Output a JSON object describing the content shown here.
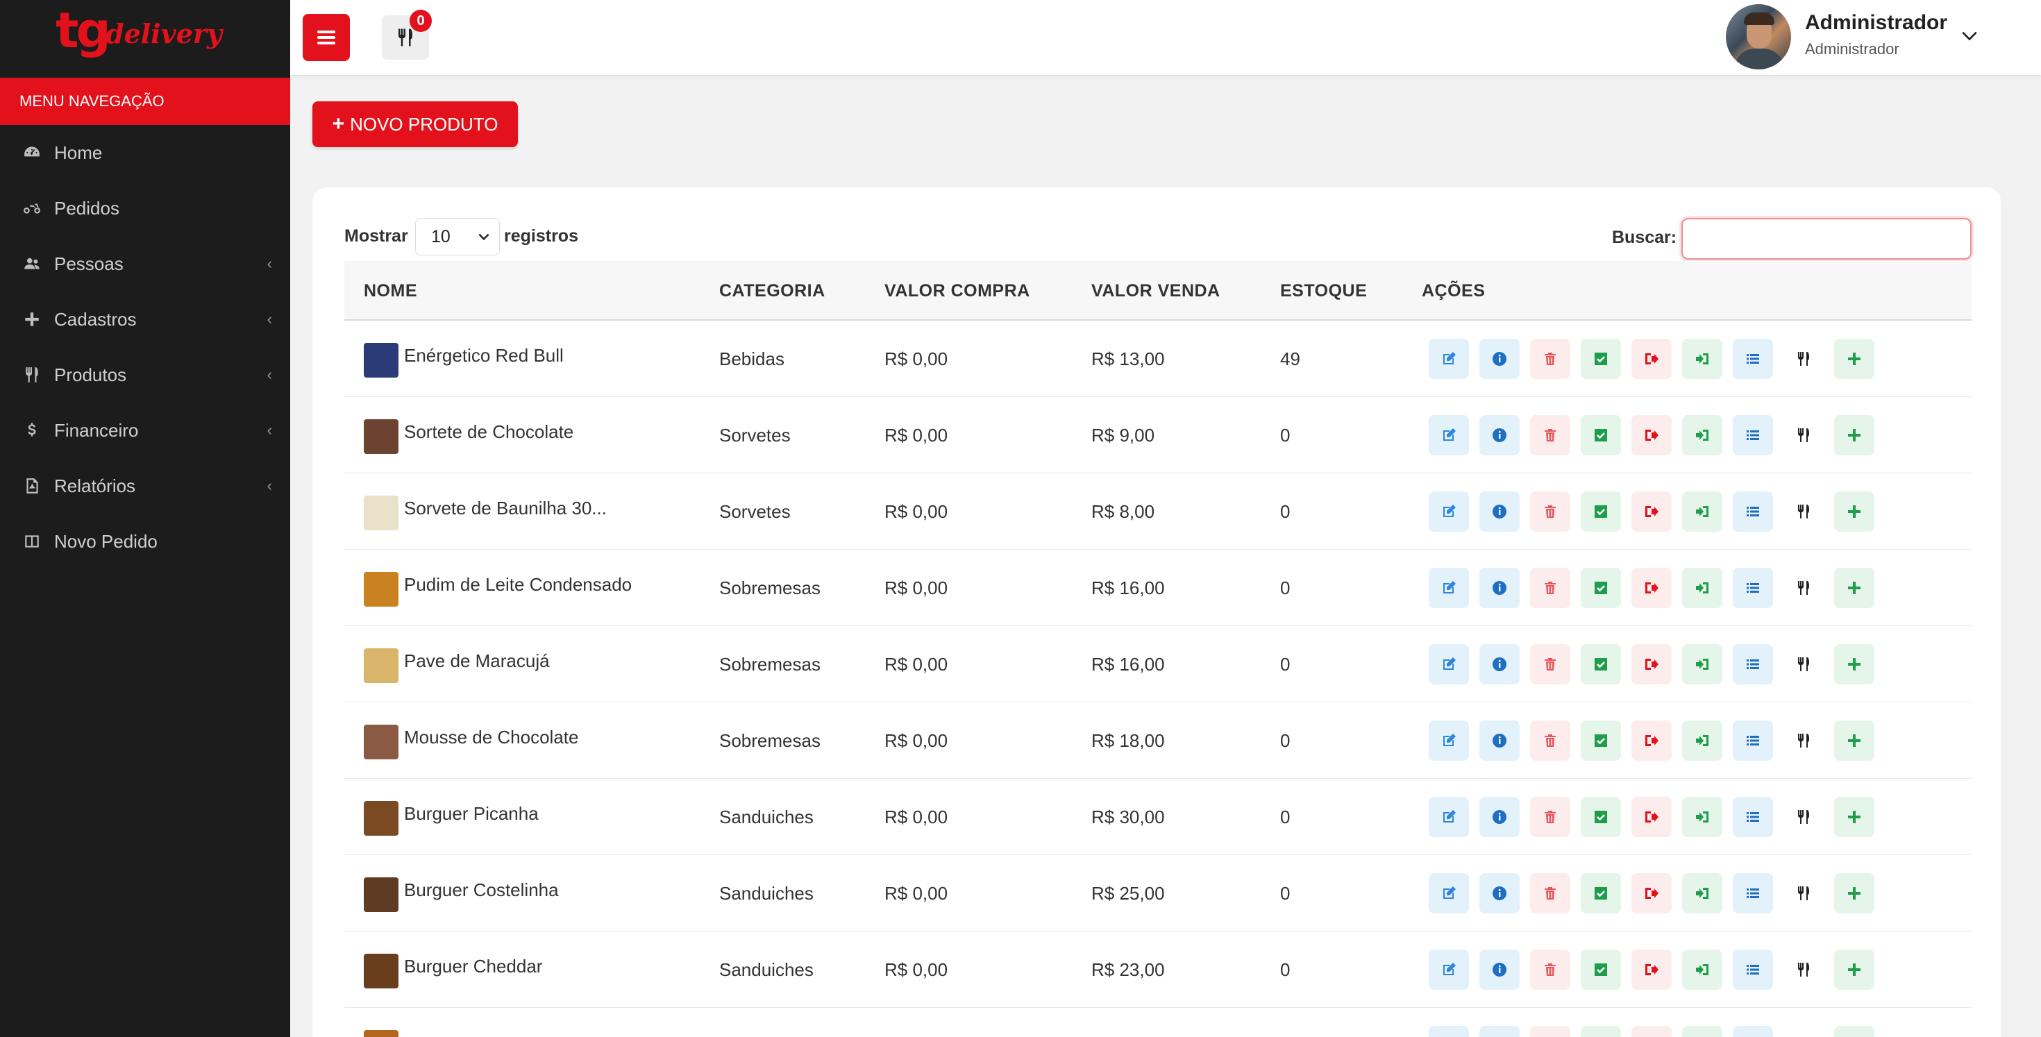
{
  "brand": {
    "logo_main": "tg",
    "logo_sub": "delivery"
  },
  "sidebar": {
    "header": "MENU NAVEGAÇÃO",
    "items": [
      {
        "label": "Home",
        "icon": "dashboard-icon",
        "expandable": false
      },
      {
        "label": "Pedidos",
        "icon": "motorcycle-icon",
        "expandable": false
      },
      {
        "label": "Pessoas",
        "icon": "users-icon",
        "expandable": true
      },
      {
        "label": "Cadastros",
        "icon": "plus-icon",
        "expandable": true
      },
      {
        "label": "Produtos",
        "icon": "utensils-icon",
        "expandable": true
      },
      {
        "label": "Financeiro",
        "icon": "dollar-icon",
        "expandable": true
      },
      {
        "label": "Relatórios",
        "icon": "pdf-file-icon",
        "expandable": true
      },
      {
        "label": "Novo Pedido",
        "icon": "columns-icon",
        "expandable": false
      }
    ]
  },
  "topbar": {
    "cart_count": "0",
    "user_name": "Administrador",
    "user_role": "Administrador"
  },
  "main": {
    "new_product_label": "NOVO PRODUTO",
    "show_label": "Mostrar",
    "show_value": "10",
    "records_label": "registros",
    "search_label": "Buscar:",
    "search_value": ""
  },
  "table": {
    "columns": [
      "NOME",
      "CATEGORIA",
      "VALOR COMPRA",
      "VALOR VENDA",
      "ESTOQUE",
      "AÇÕES"
    ],
    "rows": [
      {
        "name": "Enérgetico Red Bull",
        "category": "Bebidas",
        "buy": "R$ 0,00",
        "sell": "R$ 13,00",
        "stock": "49",
        "thumb": "#2a3b78"
      },
      {
        "name": "Sortete de Chocolate",
        "category": "Sorvetes",
        "buy": "R$ 0,00",
        "sell": "R$ 9,00",
        "stock": "0",
        "thumb": "#6b4330"
      },
      {
        "name": "Sorvete de Baunilha 30...",
        "category": "Sorvetes",
        "buy": "R$ 0,00",
        "sell": "R$ 8,00",
        "stock": "0",
        "thumb": "#e9e2c8"
      },
      {
        "name": "Pudim de Leite Condensado",
        "category": "Sobremesas",
        "buy": "R$ 0,00",
        "sell": "R$ 16,00",
        "stock": "0",
        "thumb": "#c9821f"
      },
      {
        "name": "Pave de Maracujá",
        "category": "Sobremesas",
        "buy": "R$ 0,00",
        "sell": "R$ 16,00",
        "stock": "0",
        "thumb": "#d8b56a"
      },
      {
        "name": "Mousse de Chocolate",
        "category": "Sobremesas",
        "buy": "R$ 0,00",
        "sell": "R$ 18,00",
        "stock": "0",
        "thumb": "#8a5a45"
      },
      {
        "name": "Burguer Picanha",
        "category": "Sanduiches",
        "buy": "R$ 0,00",
        "sell": "R$ 30,00",
        "stock": "0",
        "thumb": "#7a4a22"
      },
      {
        "name": "Burguer Costelinha",
        "category": "Sanduiches",
        "buy": "R$ 0,00",
        "sell": "R$ 25,00",
        "stock": "0",
        "thumb": "#5e3b22"
      },
      {
        "name": "Burguer Cheddar",
        "category": "Sanduiches",
        "buy": "R$ 0,00",
        "sell": "R$ 23,00",
        "stock": "0",
        "thumb": "#6a3d1c"
      },
      {
        "name": "",
        "category": "",
        "buy": "",
        "sell": "",
        "stock": "",
        "thumb": "#b4651e"
      }
    ],
    "actions": [
      {
        "icon": "edit-icon",
        "bg": "blue",
        "color": "#2e86de"
      },
      {
        "icon": "info-icon",
        "bg": "blue",
        "color": "#1f6fc0"
      },
      {
        "icon": "trash-icon",
        "bg": "red",
        "color": "#e8555c"
      },
      {
        "icon": "check-square-icon",
        "bg": "green",
        "color": "#1e9e4a"
      },
      {
        "icon": "sign-out-icon",
        "bg": "red",
        "color": "#e3111b"
      },
      {
        "icon": "sign-in-icon",
        "bg": "green",
        "color": "#1e9e4a"
      },
      {
        "icon": "list-icon",
        "bg": "blue",
        "color": "#1f6fc0"
      },
      {
        "icon": "utensils-icon",
        "bg": "white",
        "color": "#222222"
      },
      {
        "icon": "plus-icon",
        "bg": "green",
        "color": "#1e9e4a"
      }
    ]
  },
  "colors": {
    "accent": "#e3111b",
    "sidebar_bg": "#1c1c1c",
    "page_bg": "#f2f2f2"
  }
}
